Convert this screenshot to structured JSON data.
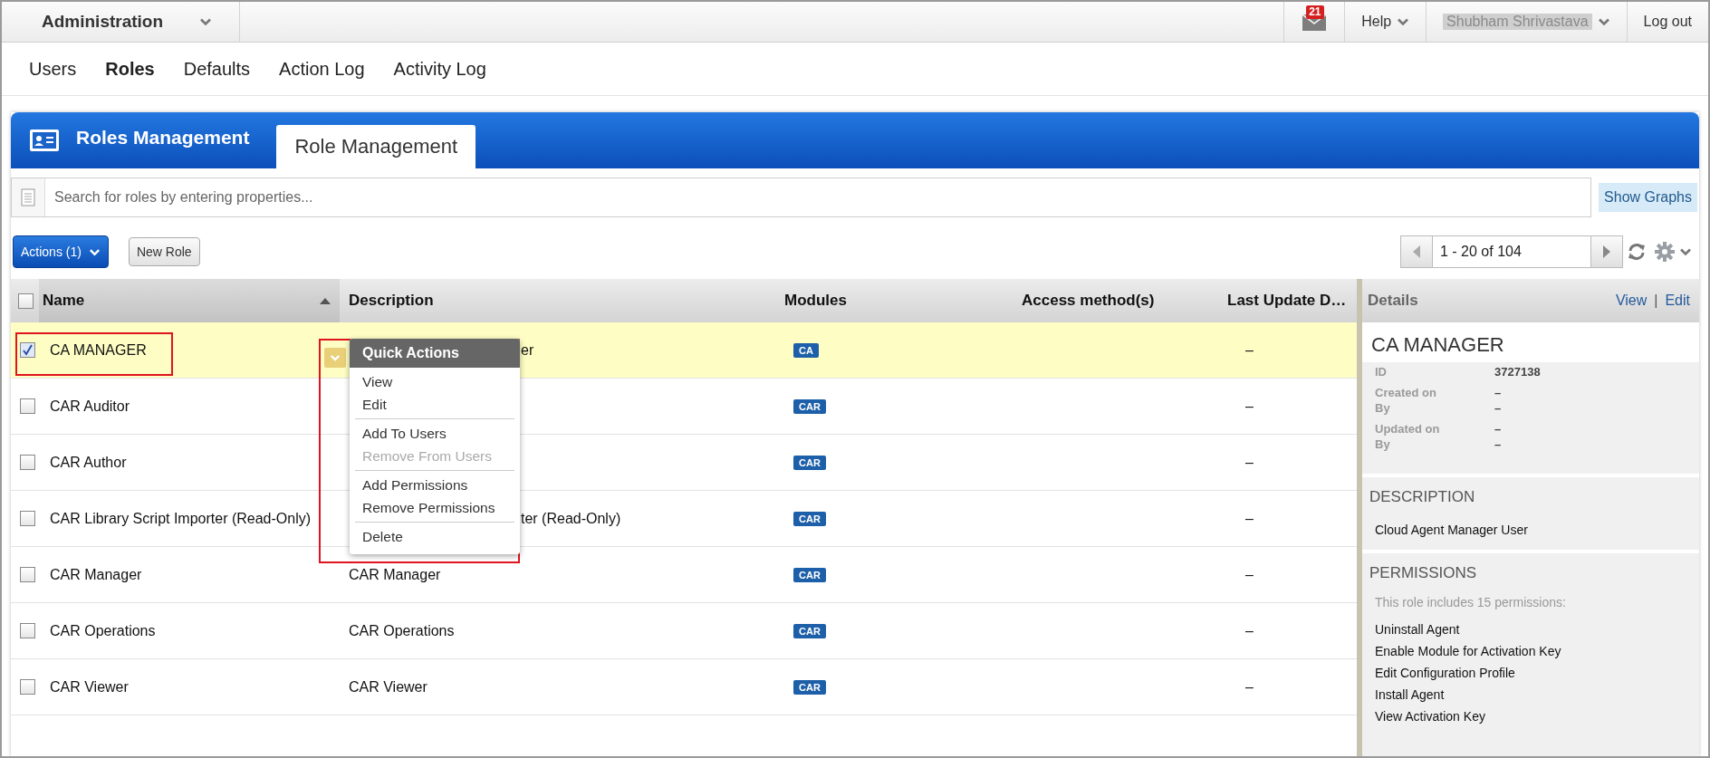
{
  "app_bar": {
    "title": "Administration",
    "notifications": "21",
    "help": "Help",
    "user": "Shubham Shrivastava",
    "logout": "Log out"
  },
  "nav_tabs": [
    {
      "label": "Users",
      "selected": false
    },
    {
      "label": "Roles",
      "selected": true
    },
    {
      "label": "Defaults",
      "selected": false
    },
    {
      "label": "Action Log",
      "selected": false
    },
    {
      "label": "Activity Log",
      "selected": false
    }
  ],
  "panel": {
    "title": "Roles Management",
    "tabs": [
      {
        "label": "Role Management",
        "selected": true
      }
    ]
  },
  "search": {
    "placeholder": "Search for roles by entering properties...",
    "show_graphs": "Show Graphs"
  },
  "toolbar": {
    "actions": "Actions (1)",
    "new_role": "New Role",
    "pager": "1 - 20 of 104"
  },
  "table": {
    "all_checked": false,
    "columns": [
      {
        "label": "Name",
        "sorted": true
      },
      {
        "label": "Description",
        "sorted": false
      },
      {
        "label": "Modules",
        "sorted": false
      },
      {
        "label": "Access method(s)",
        "sorted": false
      },
      {
        "label": "Last Update D…",
        "sorted": false
      }
    ],
    "rows": [
      {
        "checked": true,
        "selected": true,
        "name": "CA MANAGER",
        "description_tail": "er",
        "module": "CA",
        "updated": "–"
      },
      {
        "checked": false,
        "selected": false,
        "name": "CAR Auditor",
        "module": "CAR",
        "updated": "–"
      },
      {
        "checked": false,
        "selected": false,
        "name": "CAR Author",
        "module": "CAR",
        "updated": "–"
      },
      {
        "checked": false,
        "selected": false,
        "name": "CAR Library Script Importer (Read-Only)",
        "description_tail": "ter (Read-Only)",
        "module": "CAR",
        "updated": "–"
      },
      {
        "checked": false,
        "selected": false,
        "name": "CAR Manager",
        "description": "CAR Manager",
        "module": "CAR",
        "updated": "–"
      },
      {
        "checked": false,
        "selected": false,
        "name": "CAR Operations",
        "description": "CAR Operations",
        "module": "CAR",
        "updated": "–"
      },
      {
        "checked": false,
        "selected": false,
        "name": "CAR Viewer",
        "description": "CAR Viewer",
        "module": "CAR",
        "updated": "–"
      }
    ]
  },
  "quick_actions": {
    "title": "Quick Actions",
    "groups": [
      [
        {
          "label": "View",
          "disabled": false
        },
        {
          "label": "Edit",
          "disabled": false
        }
      ],
      [
        {
          "label": "Add To Users",
          "disabled": false
        },
        {
          "label": "Remove From Users",
          "disabled": true
        }
      ],
      [
        {
          "label": "Add Permissions",
          "disabled": false
        },
        {
          "label": "Remove Permissions",
          "disabled": false
        }
      ],
      [
        {
          "label": "Delete",
          "disabled": false
        }
      ]
    ]
  },
  "details": {
    "header": "Details",
    "links": [
      "View",
      "Edit"
    ],
    "link_separator": "|",
    "title": "CA MANAGER",
    "fields": [
      {
        "label": "ID",
        "value": "3727138"
      },
      {
        "label": "Created on",
        "value": "–"
      },
      {
        "label": "By",
        "value": "–"
      },
      {
        "label": "Updated on",
        "value": "–"
      },
      {
        "label": "By",
        "value": "–"
      }
    ],
    "description_heading": "DESCRIPTION",
    "description": "Cloud Agent Manager User",
    "permissions_heading": "PERMISSIONS",
    "permissions_note": "This role includes 15 permissions:",
    "permissions": [
      "Uninstall Agent",
      "Enable Module for Activation Key",
      "Edit Configuration Profile",
      "Install Agent",
      "View Activation Key"
    ]
  }
}
